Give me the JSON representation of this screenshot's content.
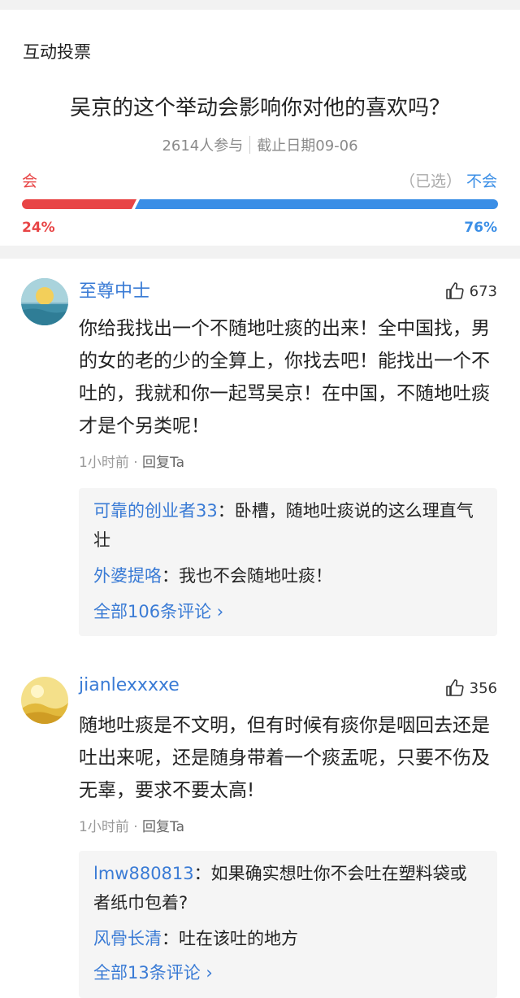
{
  "poll": {
    "title": "互动投票",
    "question": "吴京的这个举动会影响你对他的喜欢吗？",
    "participants": "2614人参与",
    "deadline": "截止日期09-06",
    "option_left": "会",
    "option_right_selected": "（已选）",
    "option_right": "不会",
    "percent_left": "24%",
    "percent_right": "76%",
    "share_left": 0.24,
    "share_right": 0.76,
    "colors": {
      "left": "#e84546",
      "right": "#3a8ee6"
    }
  },
  "comments": [
    {
      "username": "至尊中士",
      "likes": "673",
      "text": "你给我找出一个不随地吐痰的出来！全中国找，男的女的老的少的全算上，你找去吧！能找出一个不吐的，我就和你一起骂吴京！在中国，不随地吐痰才是个另类呢！",
      "time": "1小时前",
      "dot": "·",
      "reply_label": "回复Ta",
      "replies": [
        {
          "name": "可靠的创业者33",
          "text": "：卧槽，随地吐痰说的这么理直气壮"
        },
        {
          "name": "外婆提咯",
          "text": "：我也不会随地吐痰！"
        }
      ],
      "all_comments": "全部106条评论 ›"
    },
    {
      "username": "jianlexxxxe",
      "likes": "356",
      "text": "随地吐痰是不文明，但有时候有痰你是咽回去还是吐出来呢，还是随身带着一个痰盂呢，只要不伤及无辜，要求不要太高!",
      "time": "1小时前",
      "dot": "·",
      "reply_label": "回复Ta",
      "replies": [
        {
          "name": "lmw880813",
          "text": "：如果确实想吐你不会吐在塑料袋或者纸巾包着?"
        },
        {
          "name": "风骨长清",
          "text": "：吐在该吐的地方"
        }
      ],
      "all_comments": "全部13条评论 ›"
    }
  ],
  "icons": {
    "like": "thumbs-up-icon"
  }
}
